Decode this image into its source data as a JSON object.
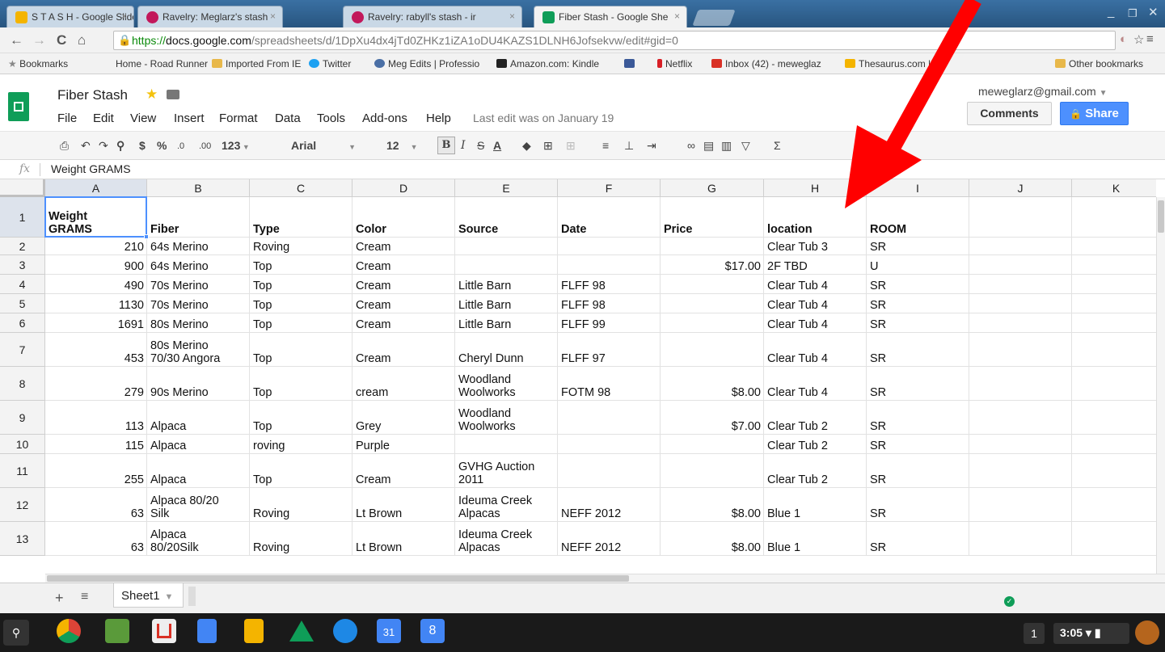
{
  "browser": {
    "tabs": [
      {
        "label": "S T A S H - Google Slide",
        "color": "#f4b400"
      },
      {
        "label": "Ravelry: Meglarz's stash",
        "color": "#c2185b"
      },
      {
        "label": "Ravelry: rabyll's stash - ir",
        "color": "#c2185b"
      },
      {
        "label": "Fiber Stash - Google She",
        "color": "#0f9d58"
      }
    ],
    "url_scheme": "https://",
    "url_host": "docs.google.com",
    "url_path": "/spreadsheets/d/1DpXu4dx4jTd0ZHKz1iZA1oDU4KAZS1DLNH6Jofsekvw/edit#gid=0",
    "bookmarks_label": "Bookmarks",
    "bookmarks": [
      {
        "label": "Home - Road Runner",
        "color": ""
      },
      {
        "label": "Imported From IE",
        "color": "#e8b84a"
      },
      {
        "label": "Twitter",
        "color": "#1da1f2"
      },
      {
        "label": "Meg Edits | Professio",
        "color": "#4a6fa5"
      },
      {
        "label": "Amazon.com: Kindle",
        "color": "#222222"
      },
      {
        "label": "",
        "color": "#3b5998"
      },
      {
        "label": "Netflix",
        "color": "#d81f26"
      },
      {
        "label": "Inbox (42) - meweglaz",
        "color": "#d93025"
      },
      {
        "label": "Thesaurus.com | Fin",
        "color": "#f4b400"
      }
    ],
    "other_bookmarks": "Other bookmarks"
  },
  "doc": {
    "title": "Fiber Stash",
    "menus": [
      "File",
      "Edit",
      "View",
      "Insert",
      "Format",
      "Data",
      "Tools",
      "Add-ons",
      "Help"
    ],
    "last_edit": "Last edit was on January 19",
    "account": "meweglarz@gmail.com",
    "comments": "Comments",
    "share": "Share"
  },
  "toolbar": {
    "currency": "$",
    "percent": "%",
    "dec_less": ".0",
    "dec_more": ".00",
    "format_more": "123",
    "font": "Arial",
    "font_size": "12",
    "bold": "B",
    "italic": "I",
    "strike": "S",
    "text_color": "A"
  },
  "formula": {
    "fx": "fx",
    "value": "Weight GRAMS"
  },
  "grid": {
    "columns": [
      "A",
      "B",
      "C",
      "D",
      "E",
      "F",
      "G",
      "H",
      "I",
      "J",
      "K"
    ],
    "row_numbers": [
      "1",
      "2",
      "3",
      "4",
      "5",
      "6",
      "7",
      "8",
      "9",
      "10",
      "11",
      "12",
      "13"
    ],
    "rows": [
      [
        "Weight\nGRAMS",
        "Fiber",
        "Type",
        "Color",
        "Source",
        "Date",
        "Price",
        "location",
        "ROOM",
        "",
        ""
      ],
      [
        "210",
        "64s Merino",
        "Roving",
        "Cream",
        "",
        "",
        "",
        "Clear Tub 3",
        "SR",
        "",
        ""
      ],
      [
        "900",
        "64s Merino",
        "Top",
        "Cream",
        "",
        "",
        "$17.00",
        "2F TBD",
        "U",
        "",
        ""
      ],
      [
        "490",
        "70s Merino",
        "Top",
        "Cream",
        "Little Barn",
        "FLFF 98",
        "",
        "Clear Tub 4",
        "SR",
        "",
        ""
      ],
      [
        "1130",
        "70s Merino",
        "Top",
        "Cream",
        "Little Barn",
        "FLFF 98",
        "",
        "Clear Tub 4",
        "SR",
        "",
        ""
      ],
      [
        "1691",
        "80s Merino",
        "Top",
        "Cream",
        "Little Barn",
        "FLFF 99",
        "",
        "Clear Tub 4",
        "SR",
        "",
        ""
      ],
      [
        "453",
        "80s Merino\n70/30 Angora",
        "Top",
        "Cream",
        "Cheryl Dunn",
        "FLFF 97",
        "",
        "Clear Tub 4",
        "SR",
        "",
        ""
      ],
      [
        "279",
        "90s Merino",
        "Top",
        "cream",
        "Woodland\nWoolworks",
        "FOTM 98",
        "$8.00",
        "Clear Tub 4",
        "SR",
        "",
        ""
      ],
      [
        "113",
        "Alpaca",
        "Top",
        "Grey",
        "Woodland\nWoolworks",
        "",
        "$7.00",
        "Clear Tub 2",
        "SR",
        "",
        ""
      ],
      [
        "115",
        "Alpaca",
        "roving",
        "Purple",
        "",
        "",
        "",
        "Clear Tub 2",
        "SR",
        "",
        ""
      ],
      [
        "255",
        "Alpaca",
        "Top",
        "Cream",
        "GVHG Auction\n2011",
        "",
        "",
        "Clear Tub 2",
        "SR",
        "",
        ""
      ],
      [
        "63",
        "Alpaca 80/20\nSilk",
        "Roving",
        "Lt Brown",
        "Ideuma Creek\nAlpacas",
        "NEFF 2012",
        "$8.00",
        "Blue 1",
        "SR",
        "",
        ""
      ],
      [
        "63",
        "Alpaca\n80/20Silk",
        "Roving",
        "Lt Brown",
        "Ideuma Creek\nAlpacas",
        "NEFF 2012",
        "$8.00",
        "Blue 1",
        "SR",
        "",
        ""
      ]
    ]
  },
  "sheets": [
    "Sheet1"
  ],
  "taskbar": {
    "time": "3:05",
    "notifications": "1"
  },
  "colors": {
    "accent": "#4d90fe",
    "sheets_green": "#0f9d58",
    "arrow": "#ff0000"
  }
}
